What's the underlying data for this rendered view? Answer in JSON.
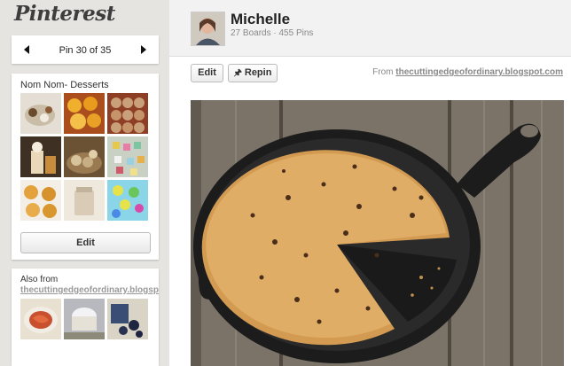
{
  "logo": "Pinterest",
  "pin_nav": {
    "label": "Pin 30 of 35"
  },
  "board": {
    "title": "Nom Nom- Desserts",
    "edit_label": "Edit",
    "thumb_colors": [
      "#d9cfc2",
      "#d9901e",
      "#b1582f",
      "#5e4a33",
      "#8a6a42",
      "#6fae8a",
      "#d89a3a",
      "#cfc4b0",
      "#8ad0c0"
    ]
  },
  "also_from": {
    "title": "Also from",
    "source": "thecuttingedgeofordinary.blogspot.com",
    "thumb_colors": [
      "#c7553b",
      "#c3c3c8",
      "#3c4c6e"
    ]
  },
  "user": {
    "name": "Michelle",
    "boards": "27 Boards",
    "pins": "455 Pins"
  },
  "actions": {
    "edit_label": "Edit",
    "repin_label": "Repin"
  },
  "source": {
    "prefix": "From",
    "link": "thecuttingedgeofordinary.blogspot.com"
  },
  "colors": {
    "accent": "#cb2027",
    "wood": "#7d7468",
    "cookie": "#d7a35d",
    "skillet": "#1c1c1c"
  }
}
